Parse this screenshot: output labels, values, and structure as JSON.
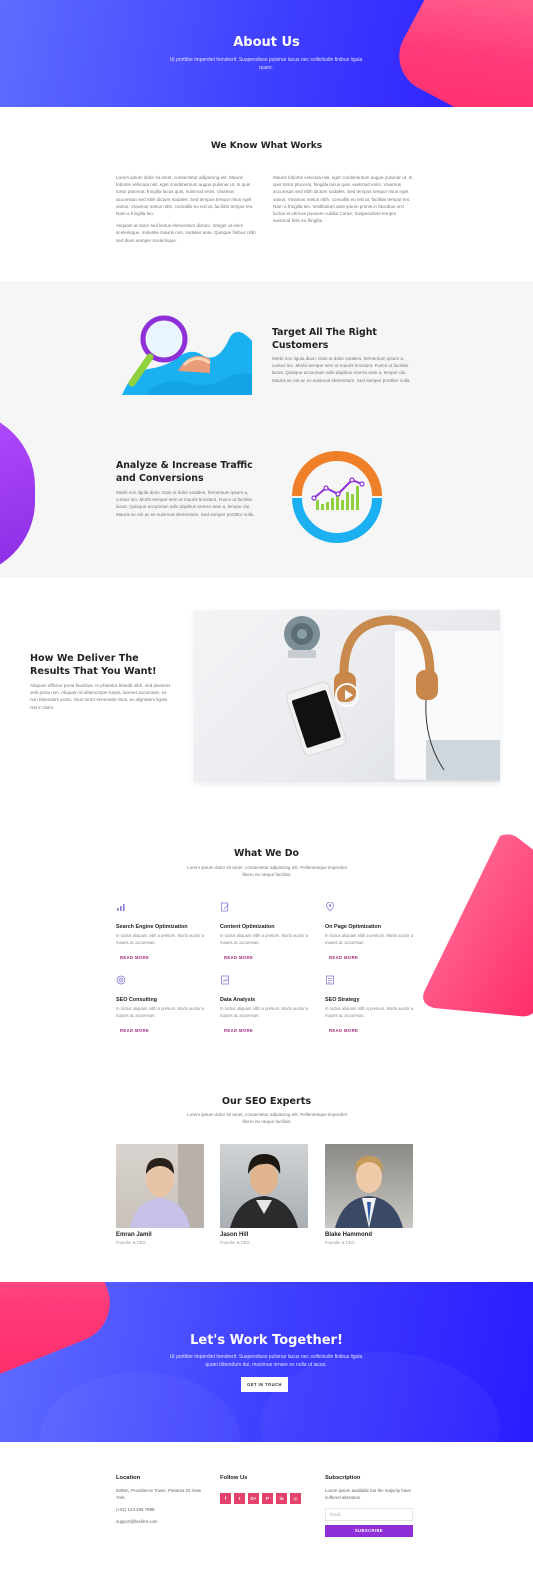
{
  "hero": {
    "title": "About Us",
    "text": "Ut porttitor imperdiet hendrerit. Suspendisse pulvinar lacus nec sollicitudin finibus ligula quam."
  },
  "know": {
    "title": "We Know What Works",
    "col1": [
      "Lorem ipsum dolor sit amet, consectetur adipiscing elit. Mauris lobortis vehicula nisl, eget condimentum augue pulvinar ut. In quis tortor placerat, fringilla lacus quis, euismod enim. Vivamus accumsan sed nibh dictum sodales. Sed tempus tempor risus eget varius. Vivamus metus nibh, convallis eu nisl at, facilisis tempor leo. Nam a fringilla leo.",
      "Aliquam at dolor sed lectus elementum dictum. Integer at enim scelerisque, molestie mauris non, sodales ante. Quisque finibus nibh sed diam semper scelerisque."
    ],
    "col2": [
      "Mauris lobortis vehicula nisl, eget condimentum augue pulvinar ut. In quis tortor placerat, fringilla lacus quis, euismod enim. Vivamus accumsan sed nibh dictum sodales. Sed tempus tempor risus eget varius. Vivamus metus nibh, convallis eu nisl at, facilisis tempor leo. Nam a fringilla leo. Vestibulum ante ipsum primis in faucibus orci luctus et ultrices posuere cubilia Curae; Suspendisse tempor euismod felis eu fringilla."
    ]
  },
  "features": {
    "f1_title": "Target All The Right Customers",
    "f1_text": "Morbi non ligula diam. Duis ut dolor sodales, fermentum ipsum a, cursus leo. Morbi semper sem ut mauris tincidunt. Fusce ut facilisis lacus. Quisque accumsan odio dapibus viverra ante a, tempor dui. Mauris ac est ac ex euismod elementum. Sed semper porttitor nulla.",
    "f2_title": "Analyze & Increase Traffic and Conversions",
    "f2_text": "Morbi non ligula diam. Duis ut dolor sodales, fermentum ipsum a, cursus leo. Morbi semper sem ut mauris tincidunt. Fusce ut facilisis lacus. Quisque accumsan odio dapibus viverra ante a, tempor dui. Mauris ac est ac ex euismod elementum. Sed semper porttitor nulla."
  },
  "deliver": {
    "title": "How We Deliver The Results That You Want!",
    "text": "Aliquam efficitur porta faucibus. In pharetra blandit nibh, sed placerat velit porta non. Aliquam id ullamcorper turpis, laoreet accumsan, ex non bibendum porta, risus tortor venenatis risus, eu dignissim ligula nisl in dolor."
  },
  "whatdo": {
    "title": "What We Do",
    "sub": "Lorem ipsum dolor sit amet, consectetur adipiscing elit. Pellentesque imperdiet libero eu neque facilisis.",
    "more": "READ MORE",
    "services": [
      {
        "title": "Search Engine Optimization",
        "text": "In luctus aliquam nibh a pretium. Morbi auctor a mauris ac accumsan."
      },
      {
        "title": "Content Optimization",
        "text": "In luctus aliquam nibh a pretium. Morbi auctor a mauris ac accumsan."
      },
      {
        "title": "On Page Optimization",
        "text": "In luctus aliquam nibh a pretium. Morbi auctor a mauris ac accumsan."
      },
      {
        "title": "SEO Consulting",
        "text": "In luctus aliquam nibh a pretium. Morbi auctor a mauris ac accumsan."
      },
      {
        "title": "Data Analysis",
        "text": "In luctus aliquam nibh a pretium. Morbi auctor a mauris ac accumsan."
      },
      {
        "title": "SEO Strategy",
        "text": "In luctus aliquam nibh a pretium. Morbi auctor a mauris ac accumsan."
      }
    ]
  },
  "experts": {
    "title": "Our SEO Experts",
    "sub": "Lorem ipsum dolor sit amet, consectetur adipiscing elit. Pellentesque imperdiet libero eu neque facilisis.",
    "members": [
      {
        "name": "Emran Jamil",
        "role": "Founder & CEO"
      },
      {
        "name": "Jason Hill",
        "role": "Founder & CEO"
      },
      {
        "name": "Blake Hammond",
        "role": "Founder & CEO"
      }
    ]
  },
  "cta": {
    "title": "Let's Work Together!",
    "text": "Ut porttitor imperdiet hendrerit. Suspendisse pulvinar lacus nec sollicitudin finibus ligula quam bibendum dui, maximus ornare ex nulla ut lacus.",
    "button": "GET IN TOUCH"
  },
  "footer": {
    "location_title": "Location",
    "address": "8255A, Providence Tower, Panama St, New York,",
    "phone": "(+01) 123 456 7898",
    "email": "support@lexfirm.com",
    "follow_title": "Follow Us",
    "social": [
      "f",
      "t",
      "G+",
      "P",
      "in",
      "◎"
    ],
    "sub_title": "Subscription",
    "sub_text": "Lorem ipsum available but the majority have suffered alteration.",
    "email_placeholder": "Email",
    "sub_button": "SUBSCRIBE"
  }
}
